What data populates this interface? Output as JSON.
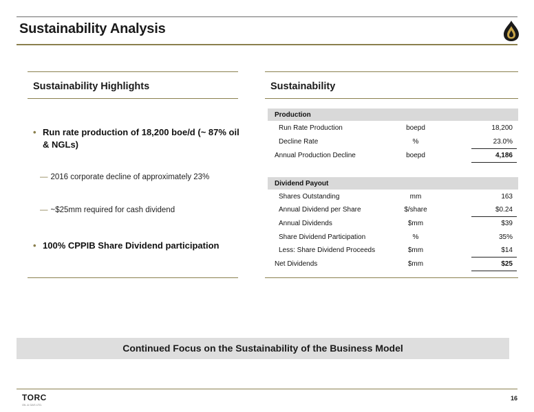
{
  "header": {
    "title": "Sustainability Analysis"
  },
  "left": {
    "heading": "Sustainability Highlights",
    "bullet1": "Run rate production of 18,200 boe/d (~ 87% oil & NGLs)",
    "sub1": "2016 corporate decline of approximately 23%",
    "sub2": "~$25mm required for cash dividend",
    "bullet2": "100% CPPIB Share Dividend participation",
    "dash": "—"
  },
  "right": {
    "heading": "Sustainability",
    "production": {
      "label": "Production",
      "rows": [
        {
          "label": "Run Rate Production",
          "unit": "boepd",
          "value": "18,200"
        },
        {
          "label": "Decline Rate",
          "unit": "%",
          "value": "23.0%"
        },
        {
          "label": "Annual Production Decline",
          "unit": "boepd",
          "value": "4,186"
        }
      ]
    },
    "dividend": {
      "label": "Dividend Payout",
      "rows": [
        {
          "label": "Shares Outstanding",
          "unit": "mm",
          "value": "163"
        },
        {
          "label": "Annual Dividend per Share",
          "unit": "$/share",
          "value": "$0.24"
        },
        {
          "label": "Annual Dividends",
          "unit": "$mm",
          "value": "$39"
        },
        {
          "label": "Share Dividend Participation",
          "unit": "%",
          "value": "35%"
        },
        {
          "label": "Less: Share Dividend Proceeds",
          "unit": "$mm",
          "value": "$14"
        },
        {
          "label": "Net Dividends",
          "unit": "$mm",
          "value": "$25"
        }
      ]
    }
  },
  "banner": {
    "text": "Continued Focus on the Sustainability of the Business Model"
  },
  "footer": {
    "logo": "TORC",
    "tagline": "OIL & GAS LTD.",
    "page": "16"
  },
  "colors": {
    "accent": "#8a7f4d",
    "band": "#d9d9d9",
    "banner": "#dedede"
  },
  "icons": {
    "header_logo": "oil-drop-logo-icon",
    "bullet": "bullet-dot-icon"
  }
}
